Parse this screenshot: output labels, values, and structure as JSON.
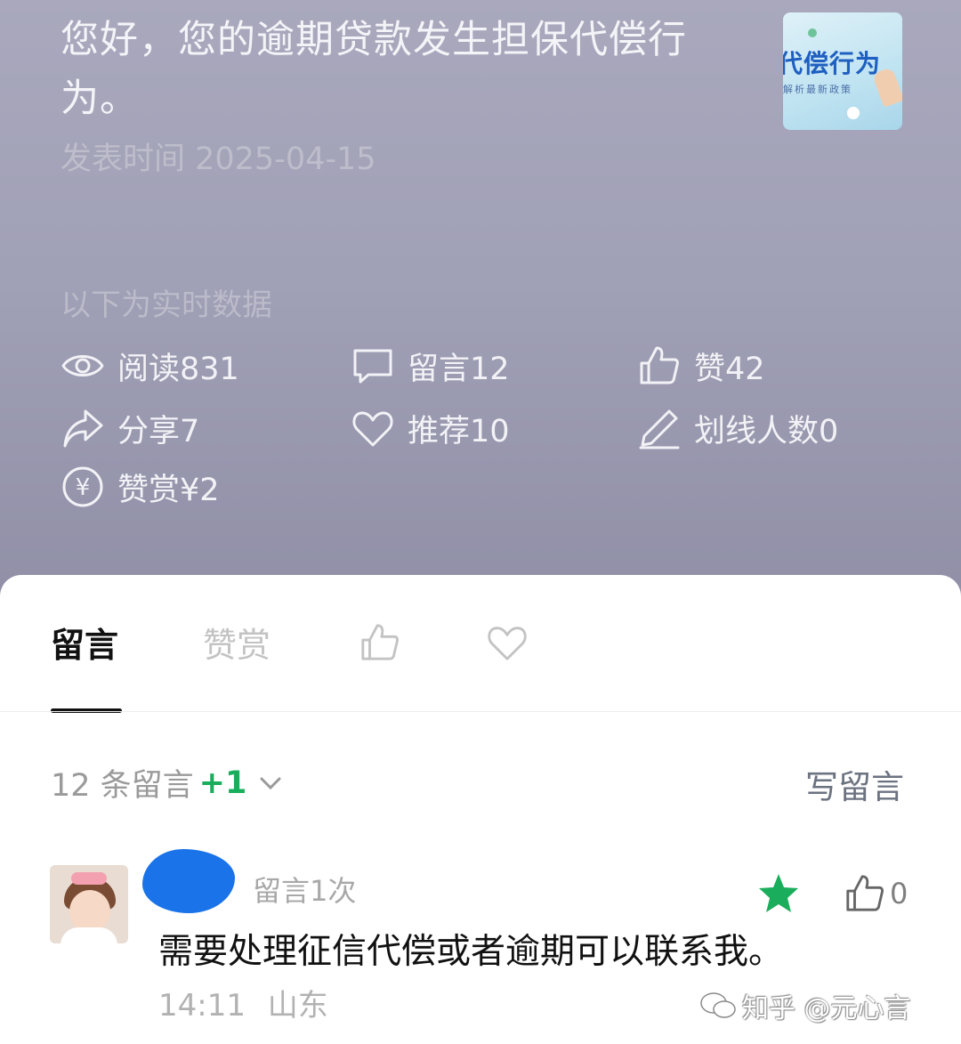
{
  "article": {
    "title": "您好，您的逾期贷款发生担保代偿行为。",
    "publish_time": "发表时间 2025-04-15",
    "thumbnail": {
      "title": "代偿行为",
      "subtitle": "解析最新政策"
    }
  },
  "stats": {
    "header": "以下为实时数据",
    "reads": "阅读831",
    "comments": "留言12",
    "likes": "赞42",
    "shares": "分享7",
    "recommends": "推荐10",
    "underline_users": "划线人数0",
    "rewards": "赞赏¥2"
  },
  "tabs": {
    "comments": "留言",
    "rewards": "赞赏"
  },
  "comments_section": {
    "count_label": "12 条留言",
    "new_badge": "+1",
    "write_label": "写留言"
  },
  "comment": {
    "meta": "留言1次",
    "like_count": "0",
    "text": "需要处理征信代偿或者逾期可以联系我。",
    "time_location": "14:11 山东"
  },
  "watermark": "知乎 @元心言",
  "colors": {
    "accent_green": "#1aad5b",
    "header_bg": "#a0a0b6"
  }
}
